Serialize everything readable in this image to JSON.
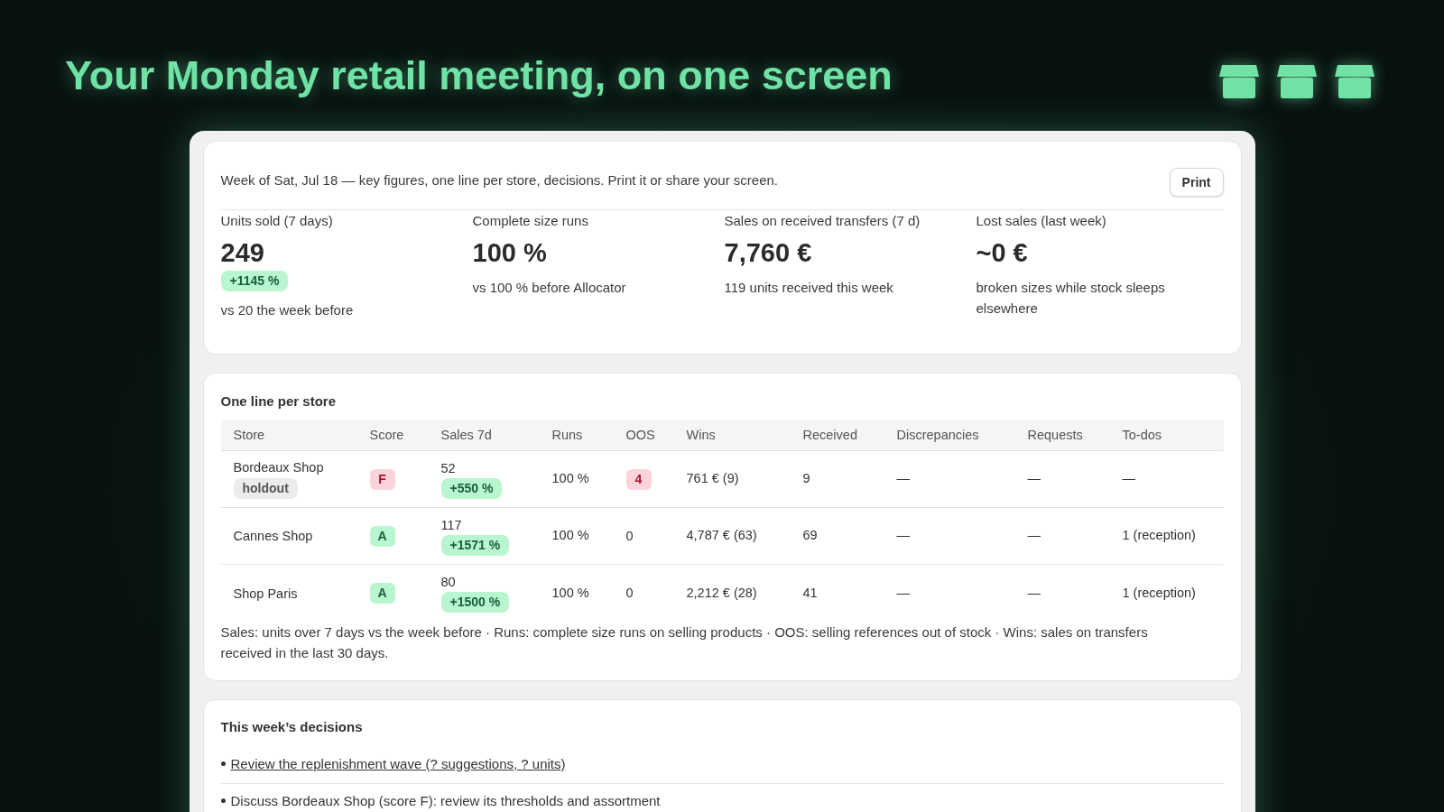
{
  "header": {
    "title": "Your Monday retail meeting, on one screen"
  },
  "summary": {
    "intro": "Week of Sat, Jul 18 — key figures, one line per store, decisions. Print it or share your screen.",
    "print_button": "Print",
    "metrics": [
      {
        "label": "Units sold (7 days)",
        "value": "249",
        "change": "+1145 %",
        "note": "vs 20 the week before"
      },
      {
        "label": "Complete size runs",
        "value": "100 %",
        "note": "vs 100 % before Allocator"
      },
      {
        "label": "Sales on received transfers (7 d)",
        "value": "7,760 €",
        "note": "119 units received this week"
      },
      {
        "label": "Lost sales (last week)",
        "value": "~0 €",
        "note": "broken sizes while stock sleeps elsewhere"
      }
    ]
  },
  "stores": {
    "title": "One line per store",
    "columns": [
      "Store",
      "Score",
      "Sales 7d",
      "Runs",
      "OOS",
      "Wins",
      "Received",
      "Discrepancies",
      "Requests",
      "To-dos"
    ],
    "rows": [
      {
        "store": "Bordeaux Shop",
        "tag": "holdout",
        "score": {
          "grade": "F",
          "flagged": true
        },
        "sales": "52",
        "change": "+550 %",
        "runs": "100 %",
        "oos": {
          "value": "4",
          "flagged": true
        },
        "wins": "761 € (9)",
        "received": "9",
        "discrepancies": "—",
        "requests": "—",
        "todos": "—"
      },
      {
        "store": "Cannes Shop",
        "score": {
          "grade": "A",
          "flagged": false
        },
        "sales": "117",
        "change": "+1571 %",
        "runs": "100 %",
        "oos": {
          "value": "0",
          "flagged": false
        },
        "wins": "4,787 € (63)",
        "received": "69",
        "discrepancies": "—",
        "requests": "—",
        "todos": "1 (reception)"
      },
      {
        "store": "Shop Paris",
        "score": {
          "grade": "A",
          "flagged": false
        },
        "sales": "80",
        "change": "+1500 %",
        "runs": "100 %",
        "oos": {
          "value": "0",
          "flagged": false
        },
        "wins": "2,212 € (28)",
        "received": "41",
        "discrepancies": "—",
        "requests": "—",
        "todos": "1 (reception)"
      }
    ],
    "footnote": "Sales: units over 7 days vs the week before · Runs: complete size runs on selling products · OOS: selling references out of stock · Wins: sales on transfers received in the last 30 days."
  },
  "decisions": {
    "title": "This week’s decisions",
    "items": [
      {
        "kind": "link",
        "text": "Review the replenishment wave (? suggestions, ? units)"
      },
      {
        "kind": "text",
        "text": "Discuss Bordeaux Shop (score F): review its thresholds and assortment"
      }
    ]
  }
}
